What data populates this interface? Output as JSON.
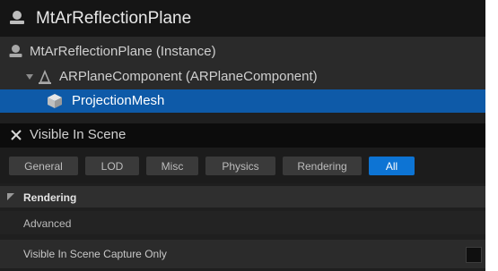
{
  "header": {
    "title": "MtArReflectionPlane",
    "icon": "actor-icon"
  },
  "tree": {
    "items": [
      {
        "label": "MtArReflectionPlane (Instance)",
        "icon": "actor-icon"
      },
      {
        "label": "ARPlaneComponent (ARPlaneComponent)",
        "icon": "component-icon",
        "expanded": true
      },
      {
        "label": "ProjectionMesh",
        "icon": "mesh-icon",
        "selected": true
      }
    ],
    "selected_color": "#0e5aa8"
  },
  "search": {
    "value": "Visible In Scene",
    "clear_icon": "close-icon"
  },
  "filters": {
    "tabs": [
      "General",
      "LOD",
      "Misc",
      "Physics",
      "Rendering",
      "All"
    ],
    "active": "All",
    "active_color": "#0d74d4"
  },
  "details": {
    "category": "Rendering",
    "subcategory": "Advanced",
    "property_label": "Visible In Scene Capture Only",
    "property_checked": false
  }
}
